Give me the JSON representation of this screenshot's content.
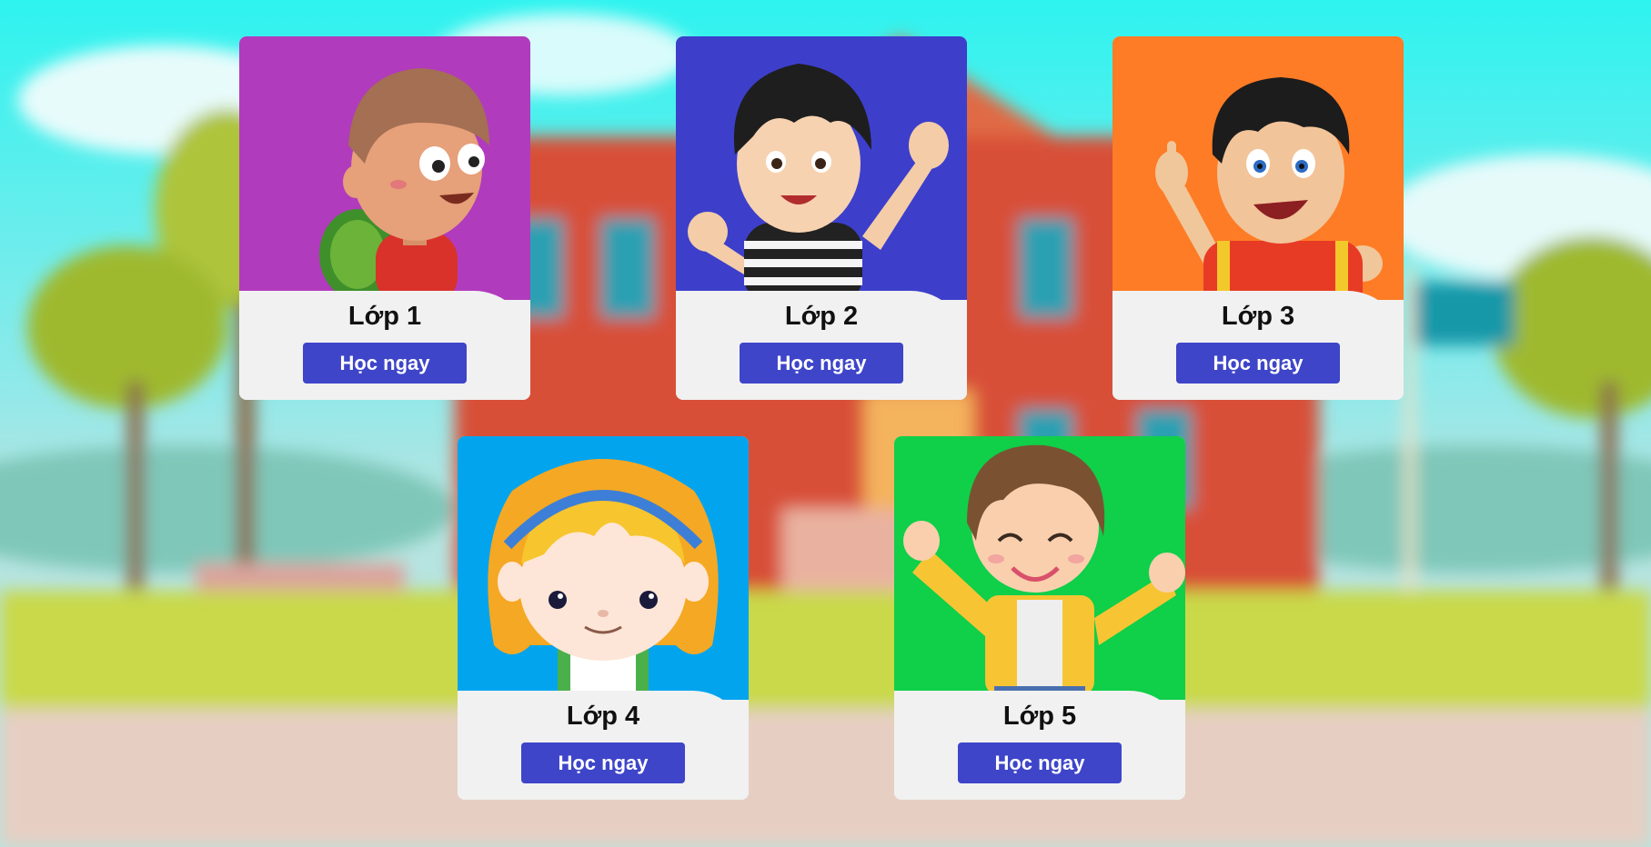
{
  "cards": [
    {
      "title": "Lớp 1",
      "button": "Học ngay",
      "color": "#b13bbd"
    },
    {
      "title": "Lớp 2",
      "button": "Học ngay",
      "color": "#3d3fcb"
    },
    {
      "title": "Lớp 3",
      "button": "Học ngay",
      "color": "#fe7c25"
    },
    {
      "title": "Lớp 4",
      "button": "Học ngay",
      "color": "#03a4ee"
    },
    {
      "title": "Lớp 5",
      "button": "Học ngay",
      "color": "#10cf49"
    }
  ],
  "colors": {
    "button": "#3e45c9",
    "card_footer": "#f1f1f1",
    "sky": "#2ef3ef",
    "school_building": "#d85038"
  },
  "background": {
    "scene": "school-building-background"
  }
}
